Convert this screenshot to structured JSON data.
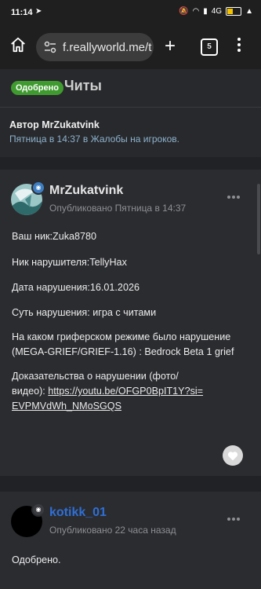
{
  "status": {
    "time": "11:14",
    "network": "4G",
    "battery_level": 0.45
  },
  "browser": {
    "url": "f.reallyworld.me/t",
    "tab_count": "5"
  },
  "thread": {
    "badge": "Одобрено",
    "title": "Читы",
    "author_line": "Автор MrZukatvink",
    "meta_line": "Пятница в 14:37 в Жалобы на игроков."
  },
  "posts": [
    {
      "username": "MrZukatvink",
      "published": "Опубликовано Пятница в 14:37",
      "username_color": "#e6e6e6",
      "lines": [
        "Ваш ник:Zuka8780",
        "Ник нарушителя:TellyHax",
        "Дата нарушения:16.01.2026",
        "Суть нарушения: игра с читами",
        "На каком гриферском режиме было нарушение (MEGA-GRIEF/GRIEF-1.16) : Bedrock Beta 1 grief",
        "Доказательства о нарушении (фото/видео):"
      ],
      "link": "https://youtu.be/OFGP0BpIT1Y?si=EVPMVdWh_NMoSGQS"
    },
    {
      "username": "kotikk_01",
      "published": "Опубликовано 22 часа назад",
      "username_color": "#2f6fd6",
      "lines": [
        "Одобрено."
      ]
    }
  ]
}
